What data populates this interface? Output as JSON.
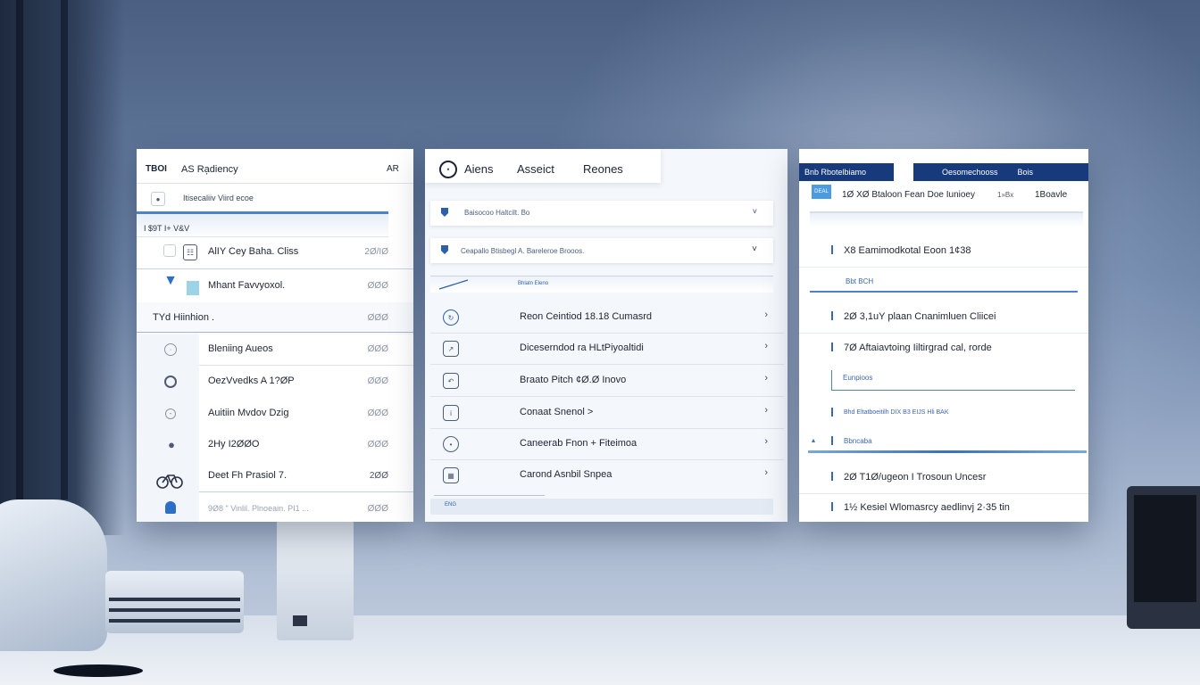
{
  "left_panel": {
    "header_left": "TBOI",
    "header_title": "AS Ra᷊diency",
    "header_right": "AR",
    "selected_text": "Itisecaliiv Viird ecoe",
    "filter_text": "I $9T I+ V&V",
    "rows_top": [
      {
        "label": "AlIY Cey Baha. Cliss",
        "value": "2Ø/IØ",
        "icon": "copy-icon"
      },
      {
        "label": "Mhant Favvyoxol.",
        "value": "ØØØ",
        "icon": "pin-icon"
      }
    ],
    "section_label": "TYd Hiinhion .",
    "section_value": "ØØØ",
    "rows": [
      {
        "label": "Bleniing Aueos",
        "value": "ØØØ",
        "icon": "clock-icon"
      },
      {
        "label": "OezVvedks A 1?ØP",
        "value": "ØØØ",
        "icon": "circle-icon"
      },
      {
        "label": "Auitiin Mvdov Dzig",
        "value": "ØØØ",
        "icon": "clock-icon"
      },
      {
        "label": "2Hy I2ØØO",
        "value": "ØØØ",
        "icon": "pin-icon"
      },
      {
        "label": "Deet Fh Prasiol 7.",
        "value": "2ØØ",
        "icon": "bike-icon"
      }
    ],
    "footer_text": "9Ø8 \" Vinlil. Plnoeain. PI1 ...",
    "footer_value": "ØØØ"
  },
  "mid_panel": {
    "tabs": [
      "Aiens",
      "Asseict",
      "Reones"
    ],
    "field1": "Baisocoo Haltcilt. Bo",
    "field2": "Ceapallo Btisbegl A. Bareleroe Brooos.",
    "bar_label": "Bhlatn Eleno",
    "rows": [
      {
        "label": "Reon Ceintiod 18.18 Cumasrd",
        "icon": "refresh-icon"
      },
      {
        "label": "Diceserndod ra HLtPiyoaltidi",
        "icon": "export-icon"
      },
      {
        "label": "Braato Pitch ¢Ø.Ø Inovo",
        "icon": "undo-icon"
      },
      {
        "label": "Conaat Snenol >",
        "icon": "info-icon"
      },
      {
        "label": "Caneerab Fnon + Fiteimoa",
        "icon": "clock-icon"
      },
      {
        "label": "Carond Asnbil Snpea",
        "icon": "grid-icon"
      }
    ],
    "footer_badge": "ENG"
  },
  "right_panel": {
    "head_left": "Bnb Rbotelbiamo",
    "head_right1": "Oesomechooss",
    "head_right2": "Bois",
    "badge": "DEAL",
    "top_line": "1Ø XØ Btaloon Fean Doe Iunioey",
    "top_line_meta": "1»Bx",
    "top_line_right": "1Boavle",
    "rows": [
      {
        "label": "X8 Eamimodkotal Eoon 1¢38",
        "sub": "Bbt BCH"
      },
      {
        "label": "2Ø 3,1uY plaan Cnanimluen Cliicei"
      },
      {
        "label": "7Ø Aftaiavtoing Iiltirgrad cal, rorde",
        "sub": "Eunpioos"
      },
      {
        "label": "Bhd Eltatboeitilh DIX B3 EIJS Hli BAK"
      },
      {
        "label": "Bbncaba"
      },
      {
        "label": "2Ø T1Ø/ugeon I Trosoun Uncesr"
      },
      {
        "label": "1½ Kesiel Wlomasrcy aedlinvj 2·35 tin"
      }
    ]
  },
  "colors": {
    "accent": "#4c83cf",
    "header_navy": "#163a7c",
    "panel_bg": "#ffffff"
  }
}
